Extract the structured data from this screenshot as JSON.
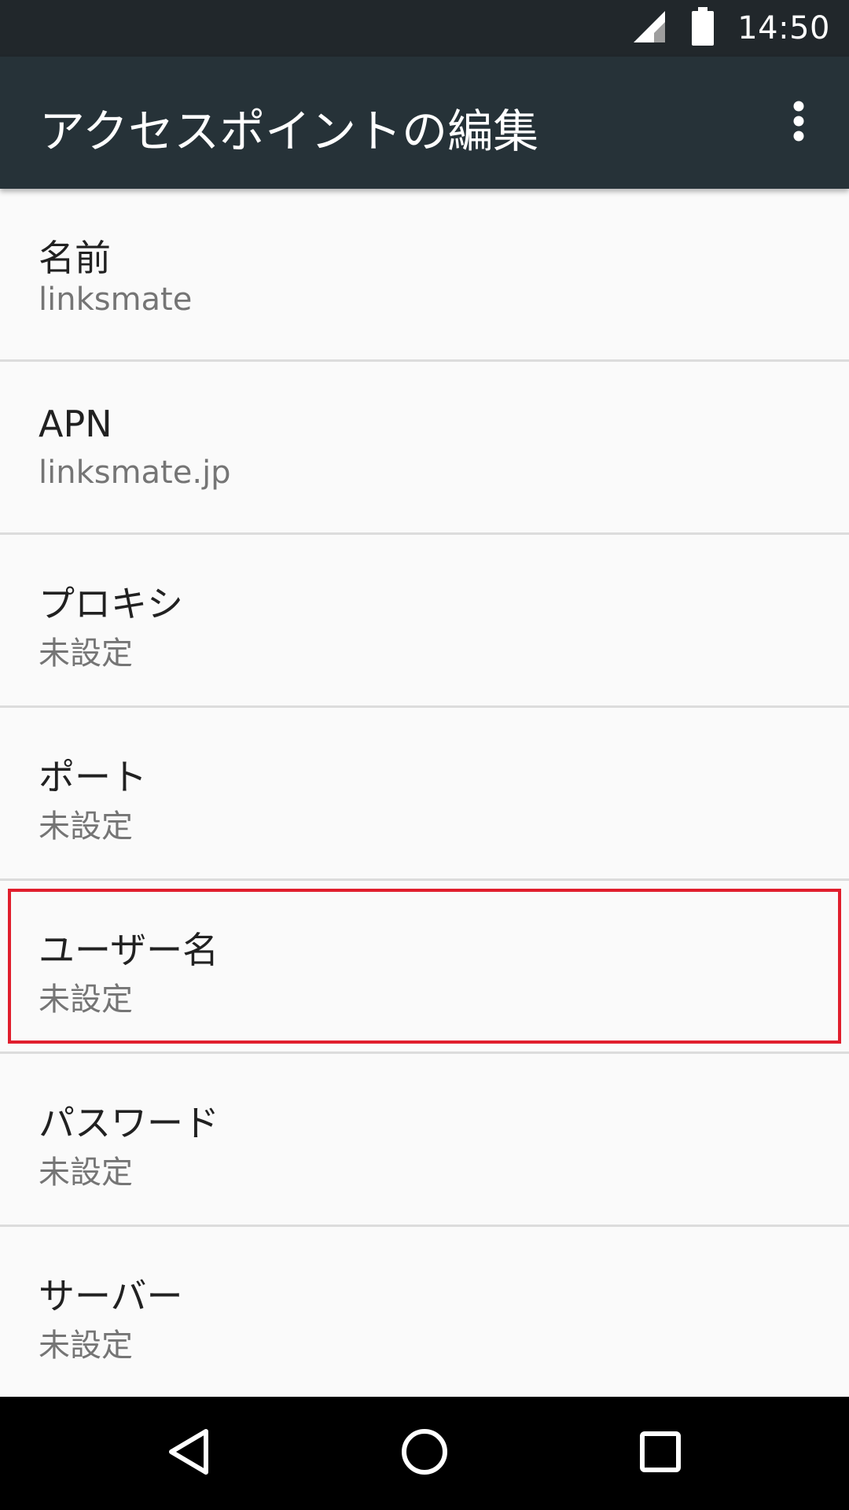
{
  "status_bar": {
    "time": "14:50",
    "icons": [
      "cell-signal-icon",
      "battery-icon"
    ]
  },
  "toolbar": {
    "title": "アクセスポイントの編集",
    "overflow_icon": "more-vert-icon"
  },
  "items": [
    {
      "label": "名前",
      "value": "linksmate"
    },
    {
      "label": "APN",
      "value": "linksmate.jp"
    },
    {
      "label": "プロキシ",
      "value": "未設定"
    },
    {
      "label": "ポート",
      "value": "未設定"
    },
    {
      "label": "ユーザー名",
      "value": "未設定"
    },
    {
      "label": "パスワード",
      "value": "未設定"
    },
    {
      "label": "サーバー",
      "value": "未設定"
    }
  ],
  "highlighted_item": "ユーザー名",
  "nav_bar": {
    "icons": [
      "back-icon",
      "home-icon",
      "recents-icon"
    ]
  },
  "colors": {
    "status_bar": "#21272b",
    "toolbar": "#263238",
    "background": "#fafafa",
    "highlight_border": "#e01e2d",
    "nav_bar": "#000000"
  }
}
